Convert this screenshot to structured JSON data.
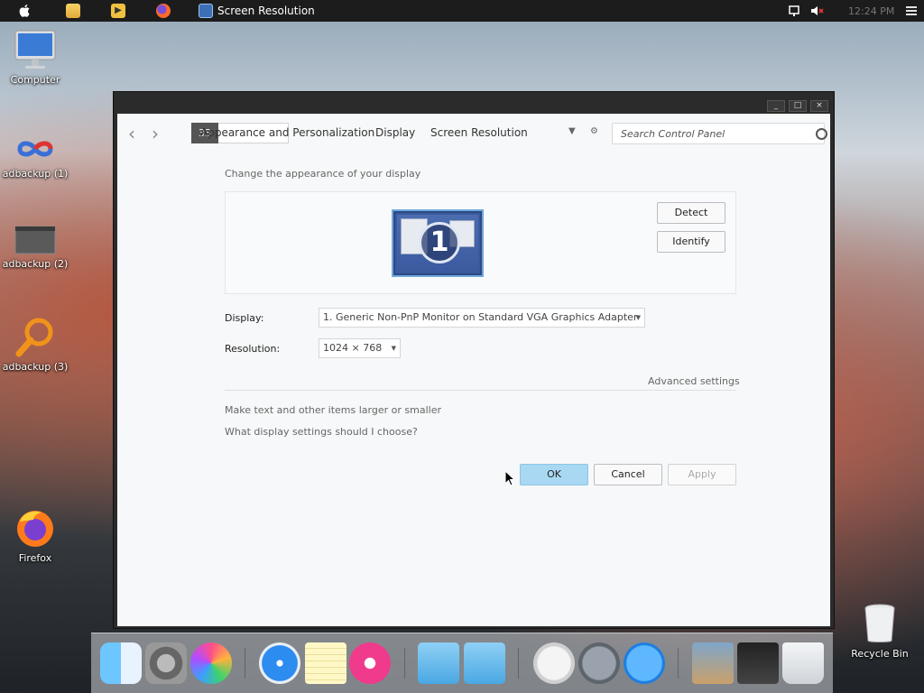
{
  "menubar": {
    "active_app_title": "Screen Resolution",
    "clock": "12:24 PM",
    "icons": [
      "apple-icon",
      "files-icon",
      "media-player-icon",
      "firefox-icon",
      "screen-resolution-icon",
      "network-icon",
      "volume-muted-icon",
      "menu-icon"
    ]
  },
  "desktop": {
    "icons": [
      {
        "label": "Computer",
        "icon": "computer-icon"
      },
      {
        "label": "adbackup (1)",
        "icon": "infinity-icon"
      },
      {
        "label": "adbackup (2)",
        "icon": "window-thumbnail-icon"
      },
      {
        "label": "adbackup (3)",
        "icon": "magnifier-icon"
      },
      {
        "label": "Firefox",
        "icon": "firefox-icon"
      },
      {
        "label": "Recycle Bin",
        "icon": "trash-icon"
      }
    ]
  },
  "window": {
    "controls": [
      "_",
      "□",
      "×"
    ],
    "address": {
      "back": "‹",
      "forward": "›",
      "breadcrumb_icon": "33",
      "crumbs": [
        "Appearance and Personalization",
        "Display",
        "Screen Resolution"
      ],
      "search_placeholder": "Search Control Panel"
    },
    "heading": "Change the appearance of your display",
    "monitor_number": "1",
    "detect_label": "Detect",
    "identify_label": "Identify",
    "display_label": "Display:",
    "display_value": "1. Generic Non-PnP Monitor on Standard VGA Graphics Adapter",
    "resolution_label": "Resolution:",
    "resolution_value": "1024 × 768",
    "advanced_link": "Advanced settings",
    "link_text_size": "Make text and other items larger or smaller",
    "link_which_settings": "What display settings should I choose?",
    "ok_label": "OK",
    "cancel_label": "Cancel",
    "apply_label": "Apply"
  },
  "dock": {
    "apps": [
      "finder-icon",
      "system-preferences-icon",
      "game-center-icon",
      "safari-icon",
      "notes-icon",
      "itunes-icon",
      "folder-icon",
      "applications-folder-icon",
      "power-icon",
      "launchpad-icon",
      "app-store-icon",
      "preview-icon",
      "photo-booth-icon",
      "trash-icon"
    ]
  },
  "colors": {
    "accent_ok": "#a9d8f2",
    "menubar": "#1c1c1c",
    "monitor_blue": "#3a5a9c"
  }
}
